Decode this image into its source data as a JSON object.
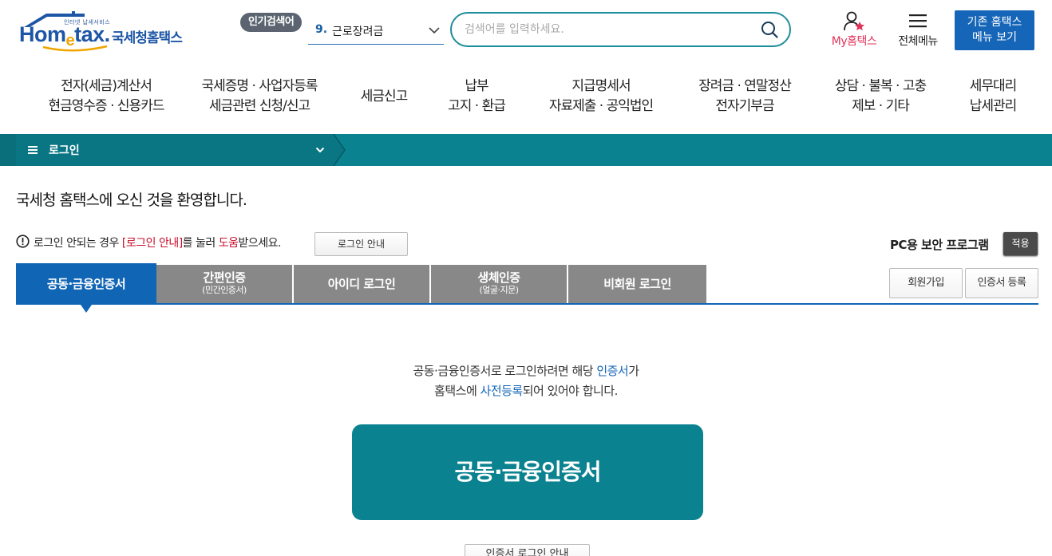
{
  "header": {
    "logo_small_text": "인터넷 납세서비스",
    "logo_word_a": "Hom",
    "logo_word_e": "e",
    "logo_word_b": "tax.",
    "logo_korean": "국세청홈택스",
    "popular_badge": "인기검색어",
    "popular_number": "9.",
    "popular_keyword": "근로장려금",
    "search_placeholder": "검색어를 입력하세요.",
    "my_hometax": "My홈택스",
    "all_menu": "전체메뉴",
    "old_menu_line1": "기존 홈택스",
    "old_menu_line2": "메뉴 보기"
  },
  "gnb": [
    {
      "line1": "전자(세금)계산서",
      "line2": "현금영수증 · 신용카드"
    },
    {
      "line1": "국세증명 · 사업자등록",
      "line2": "세금관련 신청/신고"
    },
    {
      "line1": "세금신고",
      "line2": ""
    },
    {
      "line1": "납부",
      "line2": "고지 · 환급"
    },
    {
      "line1": "지급명세서",
      "line2": "자료제출 · 공익법인"
    },
    {
      "line1": "장려금 · 연말정산",
      "line2": "전자기부금"
    },
    {
      "line1": "상담 · 불복 · 고충",
      "line2": "제보 · 기타"
    },
    {
      "line1": "세무대리",
      "line2": "납세관리"
    }
  ],
  "breadcrumb": {
    "label": "로그인"
  },
  "main": {
    "welcome": "국세청 홈택스에 오신 것을 환영합니다.",
    "help_pre": "로그인 안되는 경우 ",
    "help_link": "[로그인 안내]",
    "help_mid": "를 눌러 ",
    "help_red": "도움",
    "help_post": "받으세요.",
    "help_button": "로그인 안내",
    "security_label": "PC용 보안 프로그램",
    "security_button": "적용",
    "join_button": "회원가입",
    "cert_register_button": "인증서 등록",
    "tabs": [
      {
        "label": "공동·금융인증서",
        "sub": ""
      },
      {
        "label": "간편인증",
        "sub": "(민간인증서)"
      },
      {
        "label": "아이디 로그인",
        "sub": ""
      },
      {
        "label": "생체인증",
        "sub": "(얼굴·지문)"
      },
      {
        "label": "비회원 로그인",
        "sub": ""
      }
    ],
    "guide_1a": "공동·금융인증서로 로그인하려면 해당 ",
    "guide_1b": "인증서",
    "guide_1c": "가",
    "guide_2a": "홈택스에 ",
    "guide_2b": "사전등록",
    "guide_2c": "되어 있어야 합니다.",
    "cert_button": "공동·금융인증서",
    "cert_guide_button": "인증서 로그인 안내"
  },
  "colors": {
    "brand_blue": "#1565b8",
    "teal": "#0a8290",
    "tab_gray": "#888888",
    "accent_red": "#c8102e",
    "my_pink": "#e0335b"
  }
}
